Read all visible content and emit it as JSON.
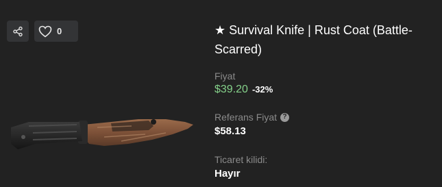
{
  "actions": {
    "share_icon": "share-icon",
    "like_icon": "heart-icon",
    "like_count": "0"
  },
  "item": {
    "title": "★ Survival Knife | Rust Coat (Battle-Scarred)",
    "image_icon": "survival-knife-image"
  },
  "price": {
    "label": "Fiyat",
    "value": "$39.20",
    "discount": "-32%",
    "color": "#85d18a"
  },
  "reference_price": {
    "label": "Referans Fiyat",
    "help_icon": "question-icon",
    "value": "$58.13"
  },
  "trade_lock": {
    "label": "Ticaret kilidi:",
    "value": "Hayır"
  }
}
